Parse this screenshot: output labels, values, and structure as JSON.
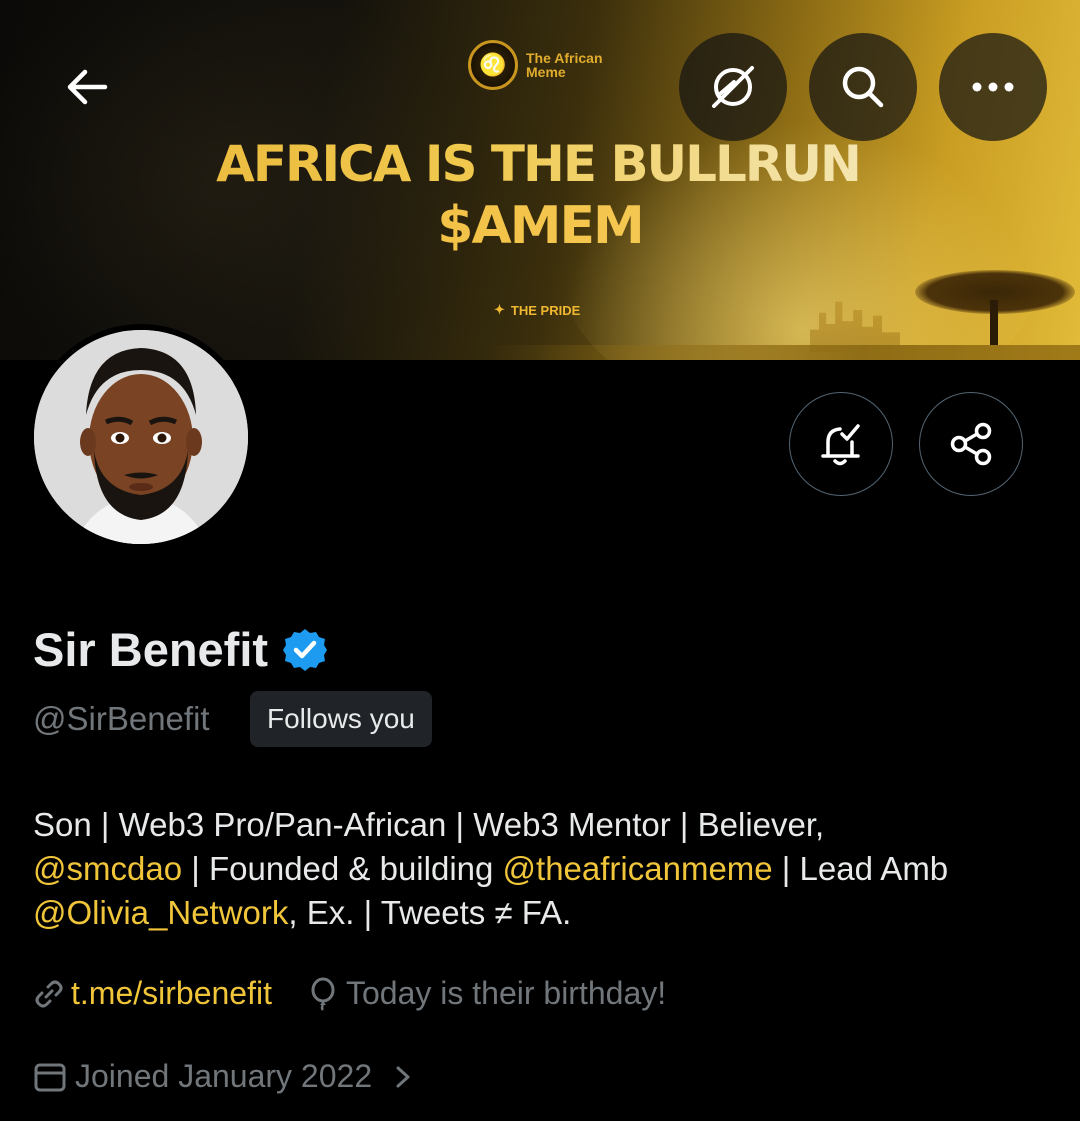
{
  "banner": {
    "brand_name": "The African Meme",
    "headline_line1": "AFRICA IS THE BULLRUN",
    "headline_line2": "$AMEM",
    "tagline": "THE PRIDE"
  },
  "nav": {
    "back_icon": "arrow-left-icon",
    "grok_icon": "grok-icon",
    "search_icon": "search-icon",
    "more_icon": "more-horizontal-icon"
  },
  "profile": {
    "display_name": "Sir Benefit",
    "handle": "@SirBenefit",
    "follows_you": "Follows you",
    "bio": {
      "part1": "Son | Web3 Pro/Pan-African | Web3 Mentor | Believer, ",
      "mention1": "@smcdao",
      "part2": " | Founded & building ",
      "mention2": "@theafricanmeme",
      "part3": " | Lead Amb ",
      "mention3": "@Olivia_Network",
      "part4": ", Ex. | Tweets ≠ FA."
    },
    "website": "t.me/sirbenefit",
    "birthday": "Today is their birthday!",
    "joined": "Joined January 2022"
  },
  "colors": {
    "accent": "#f0c53a",
    "verified": "#1d9bf0",
    "muted": "#71767b",
    "background": "#000000"
  }
}
